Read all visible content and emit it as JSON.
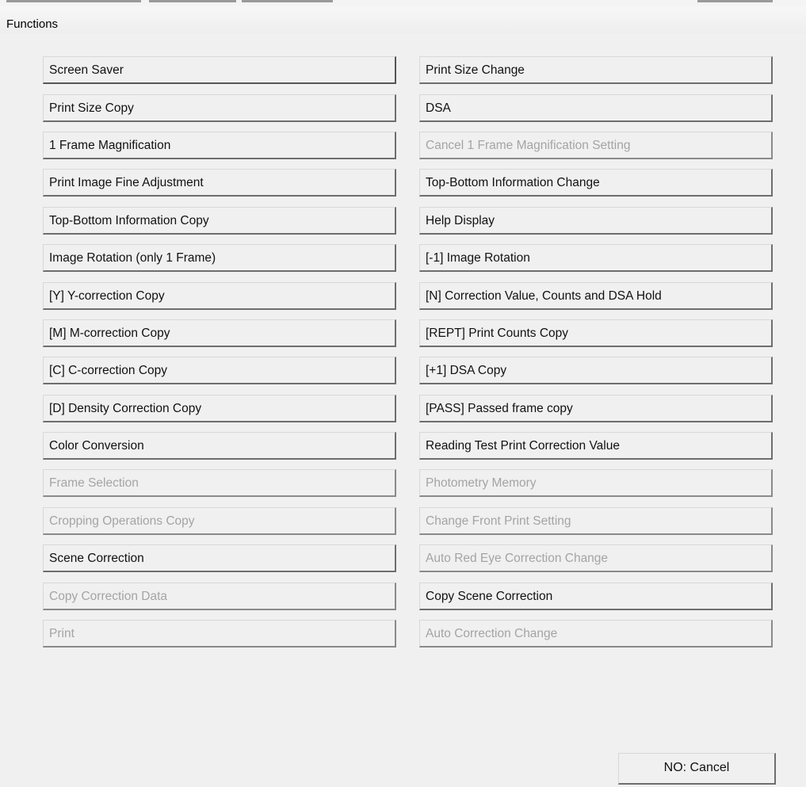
{
  "window": {
    "title": "Functions"
  },
  "buttons": [
    {
      "label": "Screen Saver",
      "enabled": true
    },
    {
      "label": "Print Size Change",
      "enabled": true
    },
    {
      "label": "Print Size Copy",
      "enabled": true
    },
    {
      "label": "DSA",
      "enabled": true
    },
    {
      "label": "1 Frame Magnification",
      "enabled": true
    },
    {
      "label": "Cancel 1 Frame Magnification Setting",
      "enabled": false
    },
    {
      "label": "Print Image Fine Adjustment",
      "enabled": true
    },
    {
      "label": "Top-Bottom Information Change",
      "enabled": true
    },
    {
      "label": "Top-Bottom Information Copy",
      "enabled": true
    },
    {
      "label": "Help Display",
      "enabled": true
    },
    {
      "label": "Image Rotation (only 1 Frame)",
      "enabled": true
    },
    {
      "label": "[-1] Image Rotation",
      "enabled": true
    },
    {
      "label": "[Y] Y-correction Copy",
      "enabled": true
    },
    {
      "label": "[N] Correction Value, Counts and DSA Hold",
      "enabled": true
    },
    {
      "label": "[M] M-correction Copy",
      "enabled": true
    },
    {
      "label": "[REPT] Print Counts Copy",
      "enabled": true
    },
    {
      "label": "[C] C-correction Copy",
      "enabled": true
    },
    {
      "label": "[+1] DSA Copy",
      "enabled": true
    },
    {
      "label": "[D] Density Correction Copy",
      "enabled": true
    },
    {
      "label": "[PASS] Passed frame copy",
      "enabled": true
    },
    {
      "label": "Color Conversion",
      "enabled": true
    },
    {
      "label": "Reading Test Print Correction Value",
      "enabled": true
    },
    {
      "label": "Frame Selection",
      "enabled": false
    },
    {
      "label": "Photometry Memory",
      "enabled": false
    },
    {
      "label": "Cropping Operations Copy",
      "enabled": false
    },
    {
      "label": "Change Front Print Setting",
      "enabled": false
    },
    {
      "label": "Scene Correction",
      "enabled": true
    },
    {
      "label": "Auto Red Eye Correction Change",
      "enabled": false
    },
    {
      "label": "Copy Correction Data",
      "enabled": false
    },
    {
      "label": "Copy Scene Correction",
      "enabled": true
    },
    {
      "label": "Print",
      "enabled": false
    },
    {
      "label": "Auto Correction Change",
      "enabled": false
    }
  ],
  "footer": {
    "cancel_label": "NO: Cancel"
  }
}
